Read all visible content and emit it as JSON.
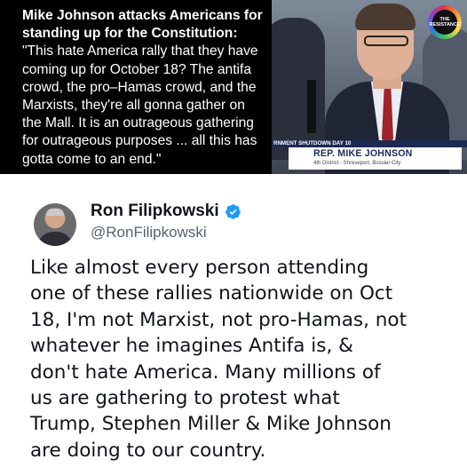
{
  "meme": {
    "headline_lines": [
      "Mike Johnson attacks Americans for",
      "standing up for the Constitution:"
    ],
    "quote_lines": [
      "\"This hate America rally that they have",
      "coming up for October 18? The antifa",
      "crowd, the pro–Hamas crowd, and the",
      "Marxists, they're all gonna gather on",
      "the Mall. It is an outrageous gathering",
      "for outrageous purposes ... all this has",
      "gotta come to an end.\""
    ]
  },
  "video": {
    "logo_lines": [
      "THE",
      "RESISTANCE"
    ],
    "ticker": "RNMENT SHUTDOWN DAY 10",
    "chyron_name": "REP. MIKE JOHNSON",
    "chyron_district": "4th District - Shreveport, Bossier City"
  },
  "tweet": {
    "display_name": "Ron Filipkowski",
    "handle": "@RonFilipkowski",
    "text_lines": [
      "Like almost every person attending",
      "one of these rallies nationwide on Oct",
      "18, I'm not Marxist, not pro-Hamas, not",
      "whatever he imagines Antifa is, &",
      "don't hate America. Many millions of",
      "us are gathering to protest what",
      "Trump, Stephen Miller & Mike Johnson",
      "are doing to our country."
    ],
    "verified_color": "#1d9bf0",
    "avatar_icon": "user-avatar"
  }
}
